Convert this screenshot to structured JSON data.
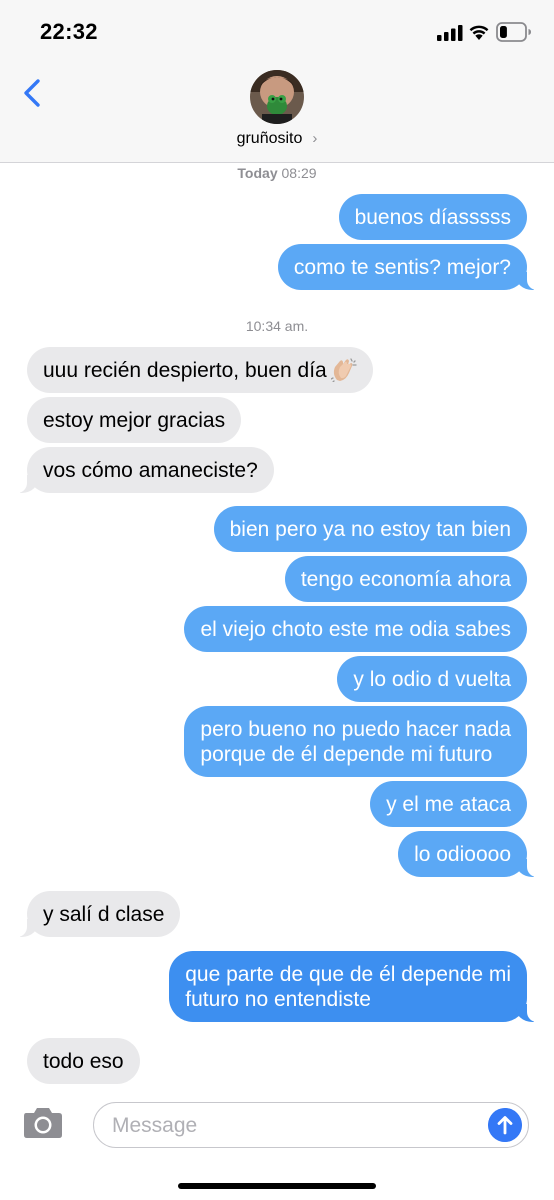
{
  "status_bar": {
    "time": "22:32",
    "battery_level": 0.3
  },
  "header": {
    "contact_name": "gruñosito",
    "chevron": "›"
  },
  "timestamps": {
    "first_day": "Today",
    "first_time": " 08:29",
    "second": "10:34 am."
  },
  "messages": [
    {
      "direction": "out",
      "text": "buenos díasssss"
    },
    {
      "direction": "out",
      "text": "como te sentis? mejor?"
    },
    {
      "direction": "in",
      "text": "uuu recién despierto, buen día",
      "emoji": "clapping-hands-icon"
    },
    {
      "direction": "in",
      "text": "estoy mejor gracias"
    },
    {
      "direction": "in",
      "text": "vos cómo amaneciste?"
    },
    {
      "direction": "out",
      "text": "bien pero ya no estoy tan bien"
    },
    {
      "direction": "out",
      "text": "tengo economía ahora"
    },
    {
      "direction": "out",
      "text": "el viejo choto este me odia sabes"
    },
    {
      "direction": "out",
      "text": "y lo odio d vuelta"
    },
    {
      "direction": "out",
      "lines": [
        "pero bueno no puedo hacer nada",
        "porque de él depende mi futuro"
      ]
    },
    {
      "direction": "out",
      "text": "y el me ataca"
    },
    {
      "direction": "out",
      "text": "lo odioooo"
    },
    {
      "direction": "in",
      "text": "y salí d clase"
    },
    {
      "direction": "out",
      "lines": [
        "que parte de que de él depende mi",
        "futuro no entendiste"
      ]
    },
    {
      "direction": "in",
      "text": "todo eso"
    }
  ],
  "composer": {
    "placeholder": "Message"
  },
  "colors": {
    "outgoing": "#5ba8f5",
    "outgoing_dark": "#3d8ff0",
    "incoming": "#e9e9eb",
    "accent": "#3478f6"
  }
}
